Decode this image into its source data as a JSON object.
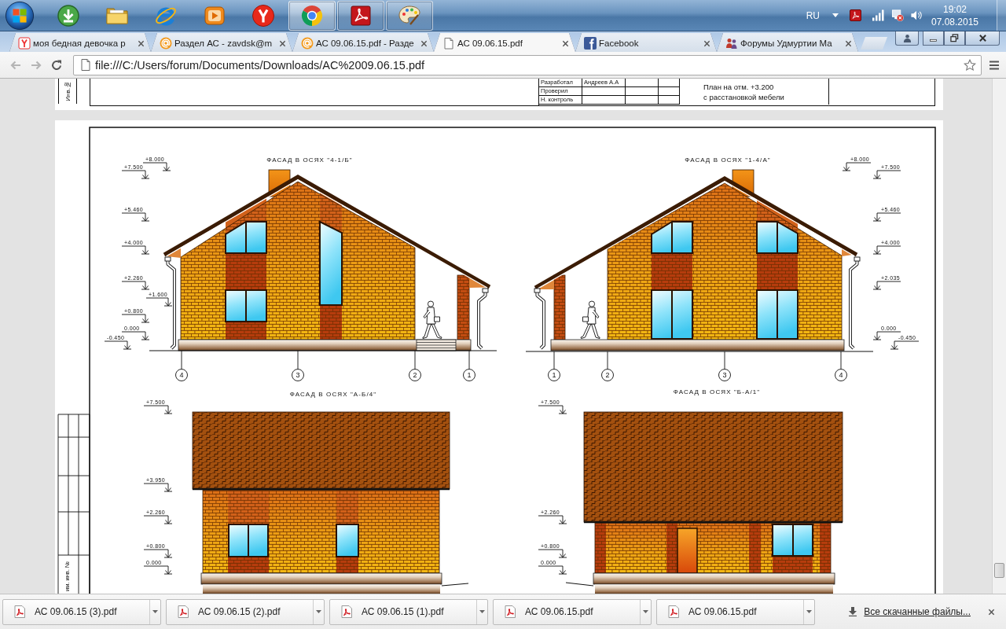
{
  "taskbar": {
    "apps": [
      {
        "kind": "download",
        "running": false,
        "selected": false
      },
      {
        "kind": "folder",
        "running": false,
        "selected": false
      },
      {
        "kind": "ie",
        "running": false,
        "selected": false
      },
      {
        "kind": "media",
        "running": false,
        "selected": false
      },
      {
        "kind": "yandex",
        "running": false,
        "selected": false
      },
      {
        "kind": "chrome",
        "running": true,
        "selected": true
      },
      {
        "kind": "acrobat",
        "running": true,
        "selected": false
      },
      {
        "kind": "paint",
        "running": true,
        "selected": false
      }
    ],
    "language": "RU",
    "time": "19:02",
    "date": "07.08.2015"
  },
  "browser": {
    "tabs": [
      {
        "kind": "yandex",
        "title": "моя бедная девочка р",
        "selected": false
      },
      {
        "kind": "mail",
        "title": "Раздел АС - zavdsk@m",
        "selected": false
      },
      {
        "kind": "mail",
        "title": "АС 09.06.15.pdf - Разде",
        "selected": false
      },
      {
        "kind": "document",
        "title": "АС 09.06.15.pdf",
        "selected": true
      },
      {
        "kind": "facebook",
        "title": "Facebook",
        "selected": false
      },
      {
        "kind": "forum",
        "title": "Форумы Удмуртии Ма",
        "selected": false
      }
    ],
    "address": "file:///C:/Users/forum/Documents/Downloads/AC%2009.06.15.pdf"
  },
  "pdf": {
    "page_1": {
      "side_label": "Инв.№",
      "signatures": [
        {
          "role": "Разработал",
          "name": "Андреев А.А"
        },
        {
          "role": "Проверил"
        },
        {
          "role": "Н. контроль"
        }
      ],
      "sheet_title": [
        "План на отм. +3.200",
        "с расстановкой мебели"
      ]
    },
    "page_2": {
      "side_label": "им. инв. №",
      "facades": [
        {
          "kind": "gable-porch-right",
          "title": "ФАСАД В ОСЯХ \"4-1/Б\"",
          "levels": [
            "+8.000",
            "+7.500",
            "+5.460",
            "+4.000",
            "+2.260",
            "+1.600",
            "+0.800",
            "0.000",
            "-0.450"
          ],
          "axes": [
            "4",
            "3",
            "2",
            "1"
          ]
        },
        {
          "kind": "gable-porch-left",
          "title": "ФАСАД В ОСЯХ \"1-4/А\"",
          "levels": [
            "+8.000",
            "+7.500",
            "+5.460",
            "+4.000",
            "+2.035",
            "0.000",
            "-0.450"
          ],
          "axes": [
            "1",
            "2",
            "3",
            "4"
          ]
        },
        {
          "kind": "end-wall",
          "title": "ФАСАД В ОСЯХ \"А-Б/4\"",
          "levels": [
            "+7.500",
            "+3.950",
            "+2.260",
            "+0.800",
            "0.000"
          ]
        },
        {
          "kind": "end-wall-door",
          "title": "ФАСАД В ОСЯХ \"Б-А/1\"",
          "levels": [
            "+7.500",
            "+2.260",
            "+0.800",
            "0.000"
          ]
        }
      ]
    }
  },
  "downloads": {
    "items": [
      "АС 09.06.15 (3).pdf",
      "АС 09.06.15 (2).pdf",
      "АС 09.06.15 (1).pdf",
      "АС 09.06.15.pdf",
      "АС 09.06.15.pdf"
    ],
    "show_all": "Все скачанные файлы..."
  }
}
